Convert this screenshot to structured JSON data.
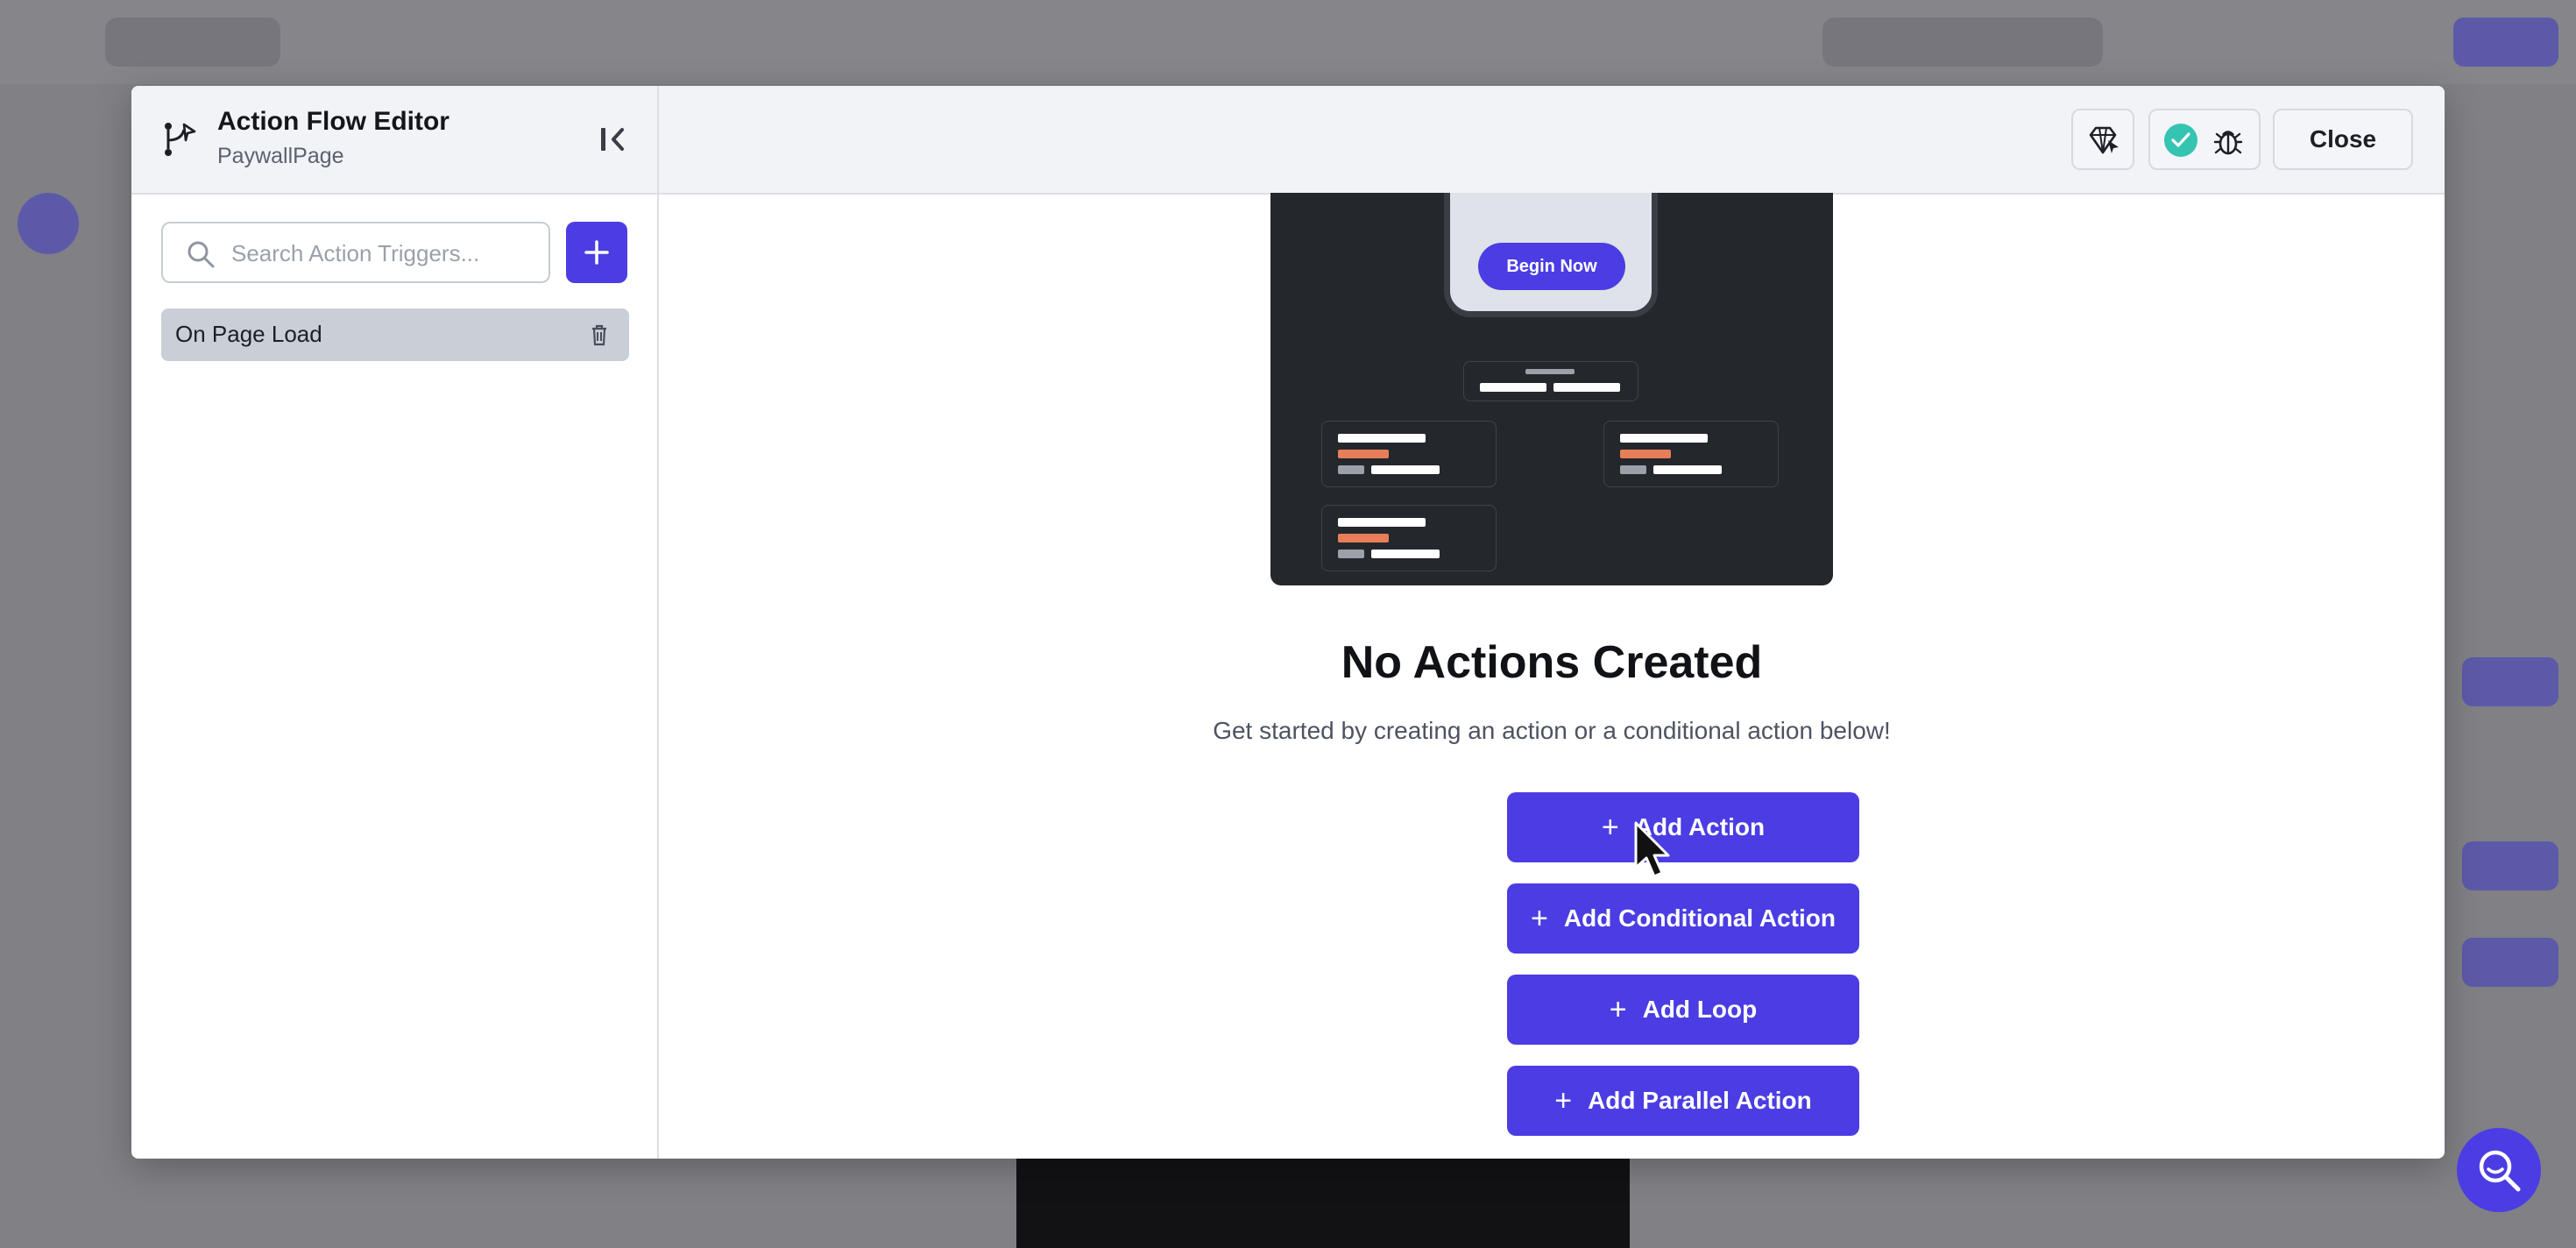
{
  "editor": {
    "title": "Action Flow Editor",
    "page_name": "PaywallPage"
  },
  "search": {
    "placeholder": "Search Action Triggers..."
  },
  "triggers": [
    {
      "label": "On Page Load",
      "selected": true
    }
  ],
  "header": {
    "close_label": "Close",
    "status": "valid"
  },
  "illustration": {
    "button_label": "Begin Now"
  },
  "empty_state": {
    "title": "No Actions Created",
    "subtitle": "Get started by creating an action or a conditional action below!"
  },
  "actions": [
    {
      "label": "Add Action"
    },
    {
      "label": "Add Conditional Action"
    },
    {
      "label": "Add Loop"
    },
    {
      "label": "Add Parallel Action"
    }
  ],
  "colors": {
    "primary": "#4b3de3",
    "success": "#36c4b2",
    "accent_orange": "#e87e59",
    "illustration_bg": "#24272c"
  }
}
